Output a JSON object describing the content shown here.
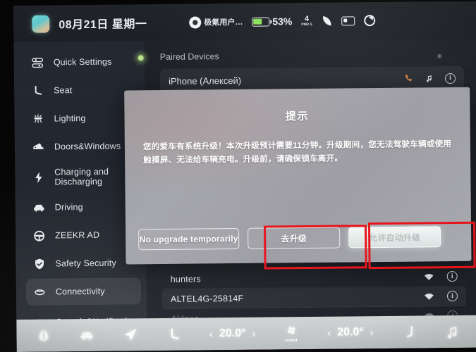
{
  "statusbar": {
    "date": "08月21日 星期一",
    "user_name": "极氪用户…",
    "battery_pct": "53%",
    "pm_value": "4",
    "pm_label": "PM2.5",
    "icons": [
      "zeekr-logo-icon",
      "user-account-icon",
      "battery-icon",
      "pm25-icon",
      "air-purifier-leaf-icon",
      "card-icon",
      "refresh-icon"
    ]
  },
  "sidebar": {
    "items": [
      {
        "label": "Quick Settings",
        "icon": "sliders-icon",
        "active": false
      },
      {
        "label": "Seat",
        "icon": "seat-icon",
        "active": false
      },
      {
        "label": "Lighting",
        "icon": "lighting-icon",
        "active": false
      },
      {
        "label": "Doors&Windows",
        "icon": "door-icon",
        "active": false
      },
      {
        "label": "Charging and Discharging",
        "icon": "bolt-icon",
        "active": false
      },
      {
        "label": "Driving",
        "icon": "car-icon",
        "active": false
      },
      {
        "label": "ZEEKR AD",
        "icon": "steering-wheel-icon",
        "active": false
      },
      {
        "label": "Safety Security",
        "icon": "shield-check-icon",
        "active": false
      },
      {
        "label": "Connectivity",
        "icon": "bluetooth-link-icon",
        "active": true
      },
      {
        "label": "Sounds&Notification",
        "icon": "speaker-icon",
        "active": false
      }
    ]
  },
  "main": {
    "section_title": "Paired Devices",
    "paired_device": {
      "name": "iPhone (Алексей)",
      "icons": [
        "phone-call-icon",
        "music-note-icon",
        "info-icon"
      ]
    },
    "wifi_networks": [
      {
        "name": "hunters",
        "dim": false
      },
      {
        "name": "ALTEL4G-25814F",
        "dim": false
      },
      {
        "name": "Aldana",
        "dim": true
      }
    ]
  },
  "dialog": {
    "title": "提示",
    "message": "您的爱车有系统升级！本次升级预计需要11分钟。升级期间，您无法驾驶车辆或使用触摸屏、无法给车辆充电。升级前，请确保锁车离开。",
    "buttons": {
      "decline": "No upgrade temporarily",
      "upgrade": "去升级",
      "auto_upgrade": "允许自动升级"
    }
  },
  "annotations": {
    "color": "#e8131b",
    "boxes": [
      "去升级-button-highlight",
      "允许自动升级-button-highlight"
    ]
  },
  "bottombar": {
    "left_temp": "20.0°",
    "right_temp": "20.0°",
    "prev_arrow": "‹",
    "next_arrow": "›",
    "icons": [
      "defrost-icon",
      "car-climate-icon",
      "navigation-icon",
      "seat-heat-icon",
      "fan-icon",
      "seat-vent-icon",
      "music-icon"
    ]
  }
}
